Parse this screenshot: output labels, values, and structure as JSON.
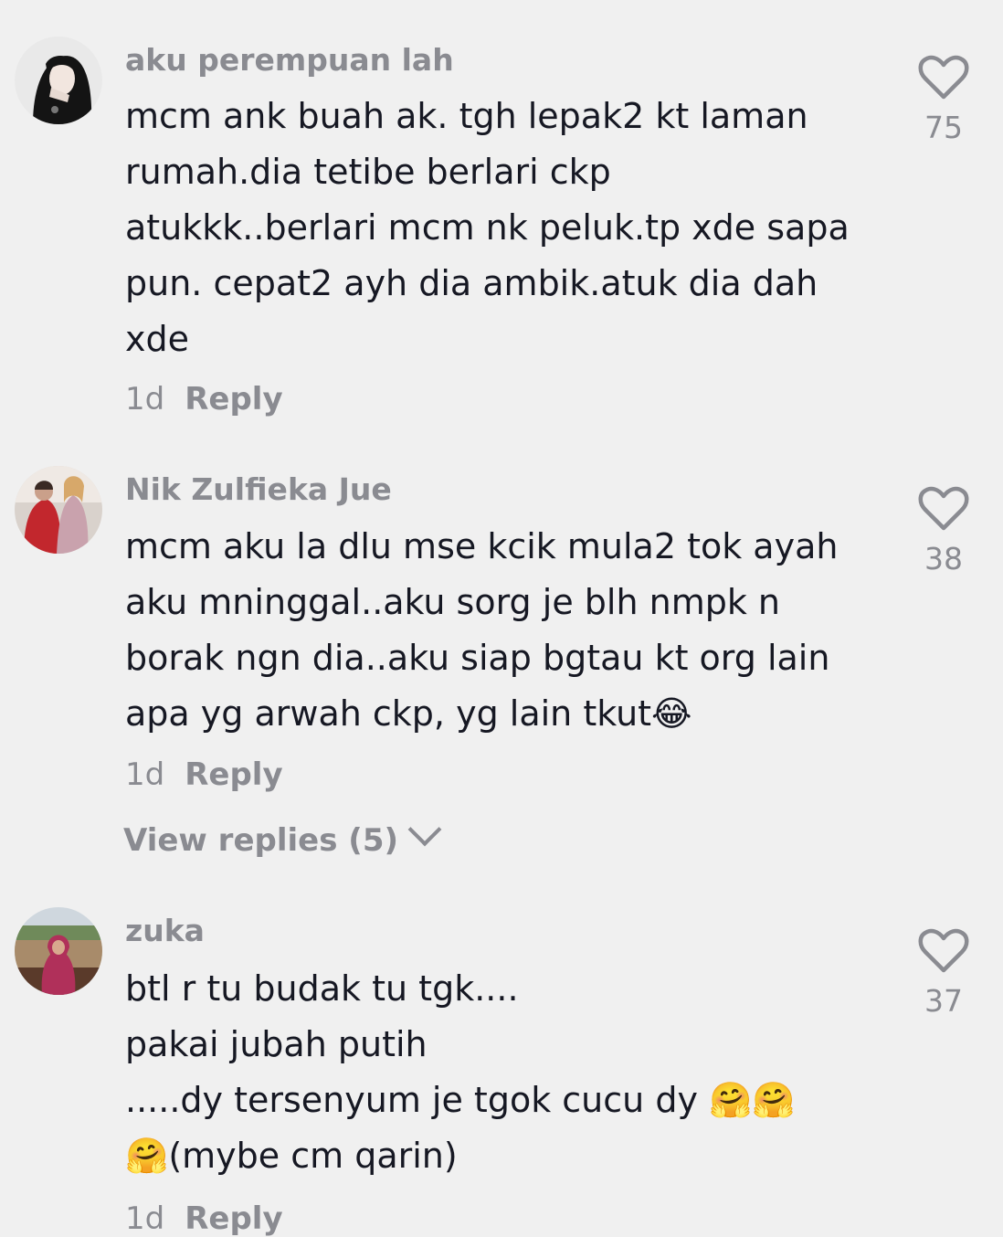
{
  "comments": [
    {
      "username": "aku perempuan lah",
      "text": "mcm ank buah ak. tgh lepak2 kt laman\nrumah.dia tetibe berlari ckp\natukkk..berlari mcm nk peluk.tp xde sapa\npun. cepat2 ayh dia ambik.atuk dia dah\nxde",
      "time": "1d",
      "reply_label": "Reply",
      "likes": "75",
      "avatar_icon": "avatar-photo"
    },
    {
      "username": "Nik Zulfieka Jue",
      "text": "mcm aku la dlu mse kcik mula2 tok ayah\naku mninggal..aku sorg je blh nmpk n\nborak ngn dia..aku siap bgtau kt org lain\napa yg arwah ckp, yg lain tkut😂",
      "time": "1d",
      "reply_label": "Reply",
      "likes": "38",
      "view_replies": "View replies (5)",
      "avatar_icon": "avatar-photo"
    },
    {
      "username": "zuka",
      "text": "btl r tu budak tu tgk....\npakai jubah putih\n.....dy tersenyum je tgok cucu dy 🤗🤗\n🤗(mybe cm qarin)",
      "time": "1d",
      "reply_label": "Reply",
      "likes": "37",
      "avatar_icon": "avatar-photo"
    }
  ],
  "icons": {
    "like": "heart-outline-icon",
    "expand": "chevron-down-icon"
  },
  "colors": {
    "background": "#f0f0f0",
    "primary_text": "#161823",
    "secondary_text": "#8a8b91"
  }
}
